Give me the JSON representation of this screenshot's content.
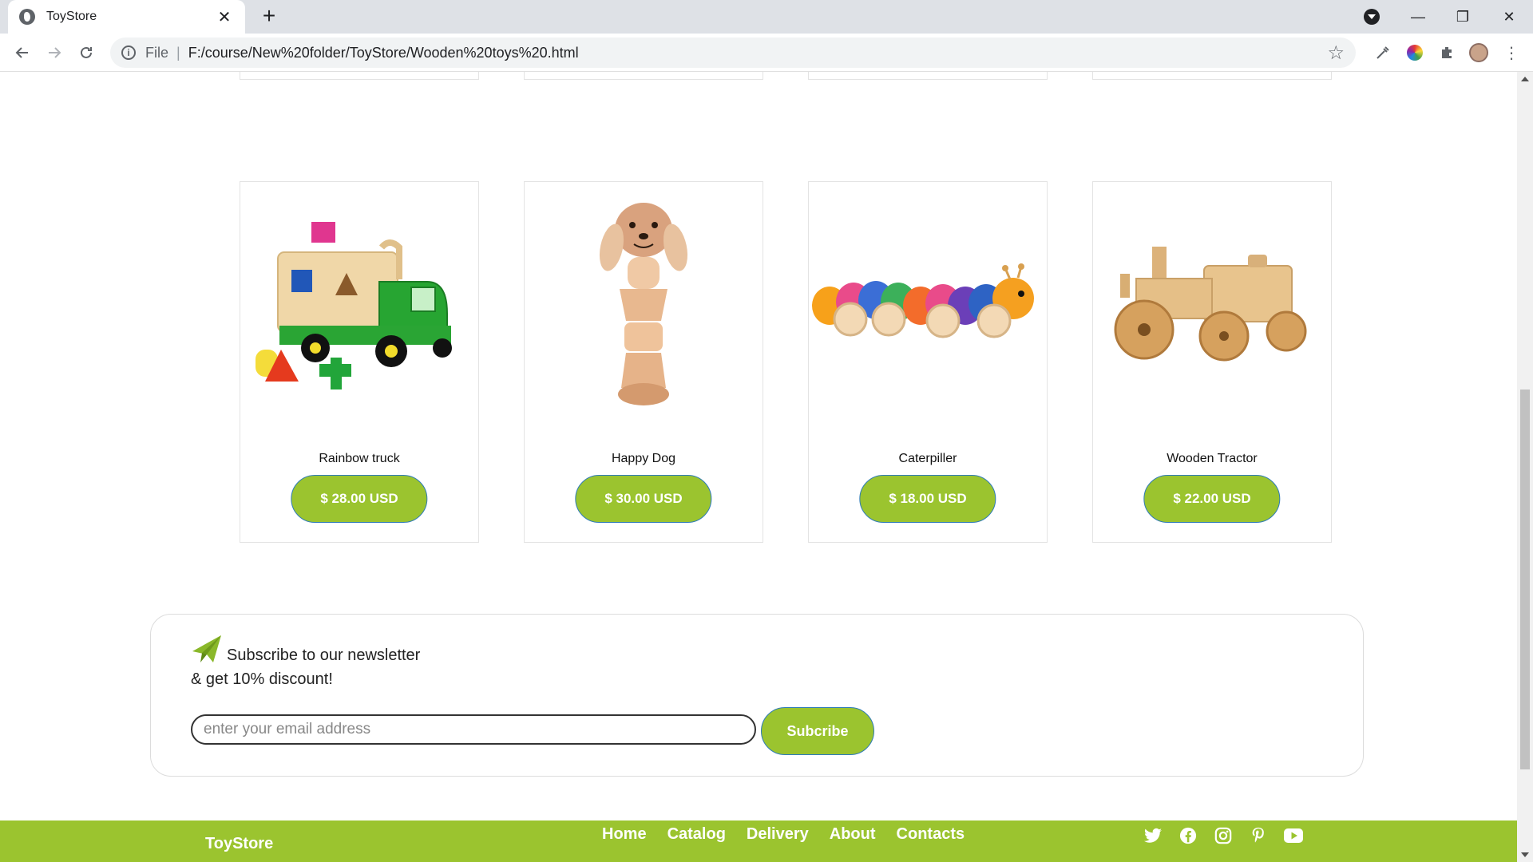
{
  "browser": {
    "tab_title": "ToyStore",
    "tab_close": "✕",
    "new_tab": "+",
    "scheme_label": "File",
    "url": "F:/course/New%20folder/ToyStore/Wooden%20toys%20.html",
    "window_controls": [
      "—",
      "❐",
      "✕"
    ]
  },
  "products": [
    {
      "name": "Rainbow truck",
      "price": "$ 28.00 USD",
      "icon": "toy-truck-image"
    },
    {
      "name": "Happy Dog",
      "price": "$ 30.00 USD",
      "icon": "wooden-dog-image"
    },
    {
      "name": "Caterpiller",
      "price": "$ 18.00 USD",
      "icon": "caterpillar-image"
    },
    {
      "name": "Wooden Tractor",
      "price": "$ 22.00 USD",
      "icon": "wooden-tractor-image"
    }
  ],
  "newsletter": {
    "line1": "Subscribe to our newsletter",
    "line2": "& get 10% discount!",
    "email_placeholder": "enter your email address",
    "button_label": "Subcribe"
  },
  "footer": {
    "brand": "ToyStore",
    "nav": [
      "Home",
      "Catalog",
      "Delivery",
      "About",
      "Contacts"
    ],
    "social_icons": [
      "twitter-icon",
      "facebook-icon",
      "instagram-icon",
      "pinterest-icon",
      "youtube-icon"
    ]
  },
  "colors": {
    "accent_green": "#9bc42f",
    "button_border": "#2e7bb8"
  }
}
